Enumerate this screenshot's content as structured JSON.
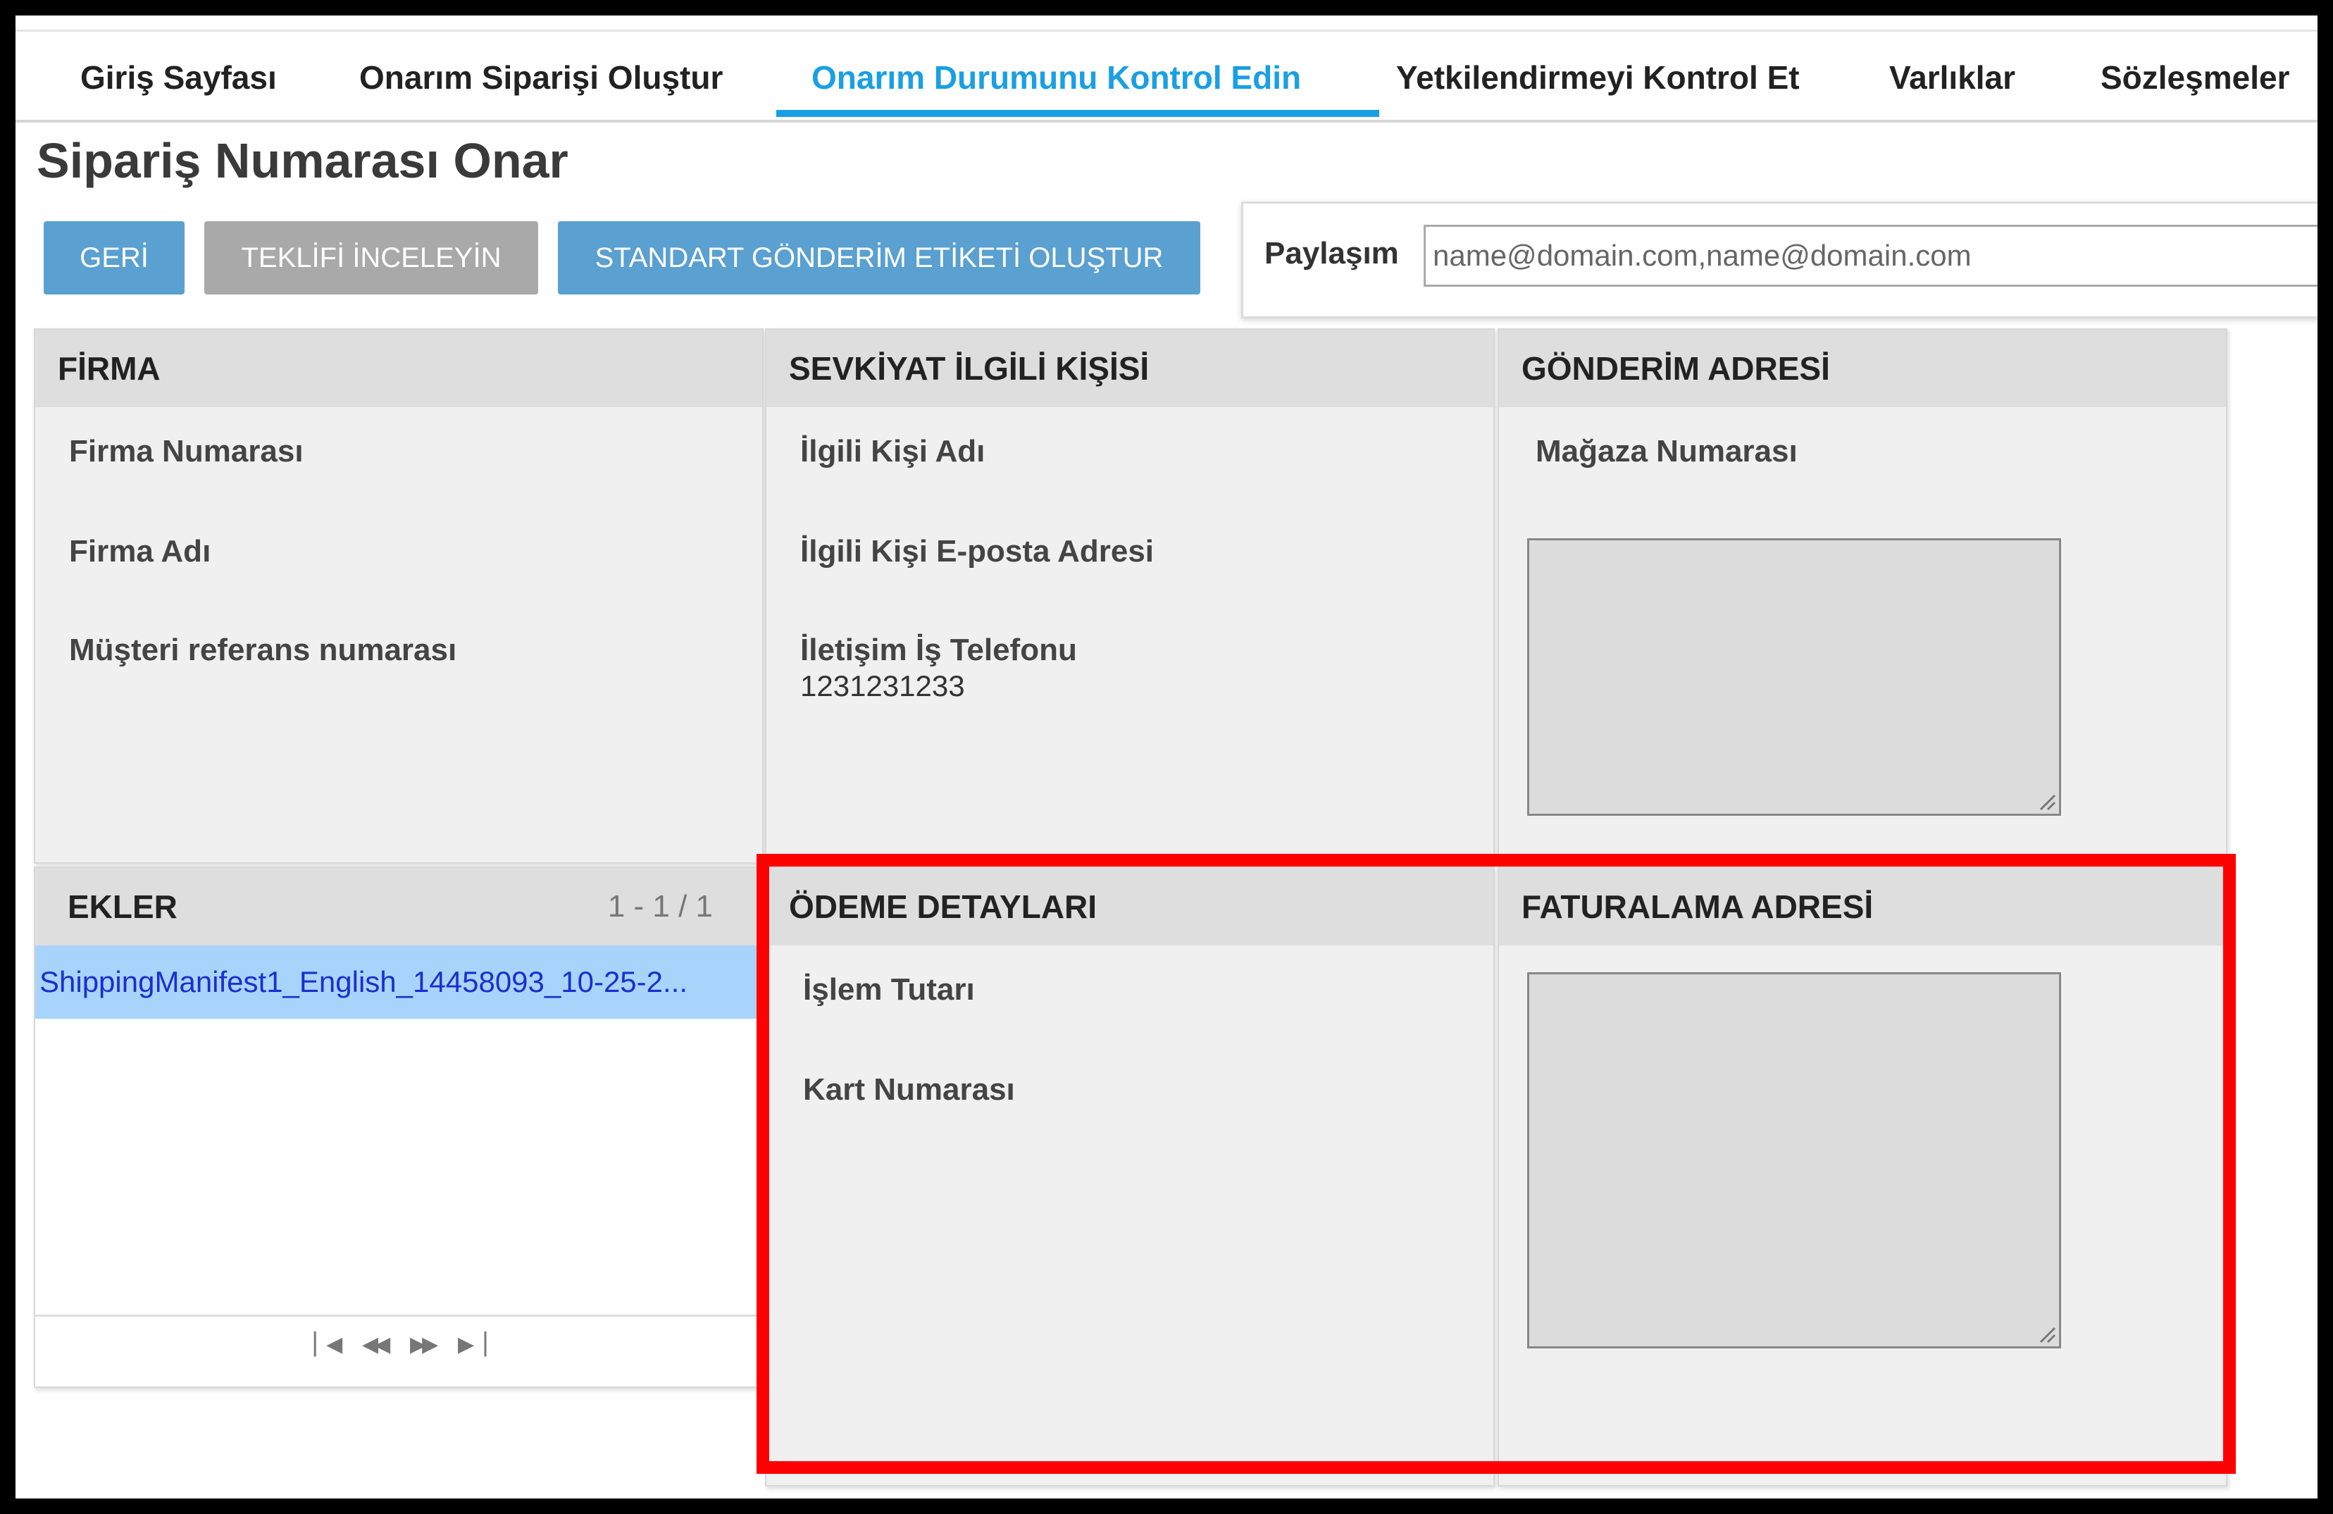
{
  "nav": {
    "tabs": [
      {
        "label": "Giriş Sayfası"
      },
      {
        "label": "Onarım Siparişi Oluştur"
      },
      {
        "label": "Onarım Durumunu Kontrol Edin"
      },
      {
        "label": "Yetkilendirmeyi Kontrol Et"
      },
      {
        "label": "Varlıklar"
      },
      {
        "label": "Sözleşmeler"
      }
    ],
    "active_tab": "Onarım Durumunu Kontrol Edin",
    "accent_color": "#1a9fe3"
  },
  "page": {
    "title": "Sipariş Numarası Onar"
  },
  "toolbar": {
    "back_label": "GERİ",
    "quote_label": "TEKLİFİ İNCELEYİN",
    "label_button": "STANDART GÖNDERİM ETİKETİ OLUŞTUR"
  },
  "share": {
    "label": "Paylaşım",
    "placeholder": "name@domain.com,name@domain.com"
  },
  "firma": {
    "title": "FİRMA",
    "fields": [
      "Firma Numarası",
      "Firma Adı",
      "Müşteri referans numarası"
    ]
  },
  "contact": {
    "title": "SEVKİYAT İLGİLİ KİŞİSİ",
    "name_label": "İlgili Kişi Adı",
    "email_label": "İlgili Kişi E-posta Adresi",
    "phone_label": "İletişim İş Telefonu",
    "phone_value": "1231231233"
  },
  "shipping": {
    "title": "GÖNDERİM ADRESİ",
    "store_label": "Mağaza Numarası"
  },
  "attachments": {
    "title": "EKLER",
    "count": "1 - 1 / 1",
    "items": [
      "ShippingManifest1_English_14458093_10-25-2..."
    ]
  },
  "payment": {
    "title": "ÖDEME DETAYLARI",
    "amount_label": "İşlem Tutarı",
    "card_label": "Kart Numarası"
  },
  "billing": {
    "title": "FATURALAMA ADRESİ"
  }
}
